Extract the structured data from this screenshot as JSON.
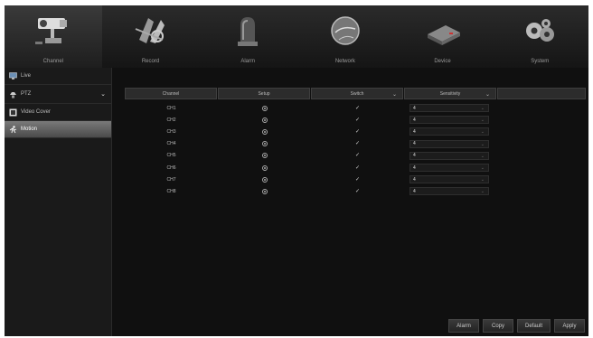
{
  "topnav": {
    "tabs": [
      {
        "label": "Channel",
        "icon": "camera-icon",
        "active": true
      },
      {
        "label": "Record",
        "icon": "film-reel-icon",
        "active": false
      },
      {
        "label": "Alarm",
        "icon": "siren-light-icon",
        "active": false
      },
      {
        "label": "Network",
        "icon": "globe-icon",
        "active": false
      },
      {
        "label": "Device",
        "icon": "hard-drive-icon",
        "active": false
      },
      {
        "label": "System",
        "icon": "gears-icon",
        "active": false
      }
    ]
  },
  "sidebar": {
    "items": [
      {
        "label": "Live",
        "icon": "monitor-icon"
      },
      {
        "label": "PTZ",
        "icon": "ptz-camera-icon"
      },
      {
        "label": "Video Cover",
        "icon": "video-cover-icon"
      },
      {
        "label": "Motion",
        "icon": "running-person-icon"
      }
    ],
    "active": "Motion"
  },
  "table": {
    "headers": {
      "channel": "Channel",
      "setup": "Setup",
      "switch": "Switch",
      "sensitivity": "Sensitivity"
    },
    "rows": [
      {
        "channel": "CH1",
        "switch": "✓",
        "sensitivity": "4"
      },
      {
        "channel": "CH2",
        "switch": "✓",
        "sensitivity": "4"
      },
      {
        "channel": "CH3",
        "switch": "✓",
        "sensitivity": "4"
      },
      {
        "channel": "CH4",
        "switch": "✓",
        "sensitivity": "4"
      },
      {
        "channel": "CH5",
        "switch": "✓",
        "sensitivity": "4"
      },
      {
        "channel": "CH6",
        "switch": "✓",
        "sensitivity": "4"
      },
      {
        "channel": "CH7",
        "switch": "✓",
        "sensitivity": "4"
      },
      {
        "channel": "CH8",
        "switch": "✓",
        "sensitivity": "4"
      }
    ]
  },
  "buttons": {
    "alarm": "Alarm",
    "copy": "Copy",
    "default": "Default",
    "apply": "Apply"
  },
  "colors": {
    "background": "#101010",
    "active_sidebar": "#6a6a6a"
  }
}
